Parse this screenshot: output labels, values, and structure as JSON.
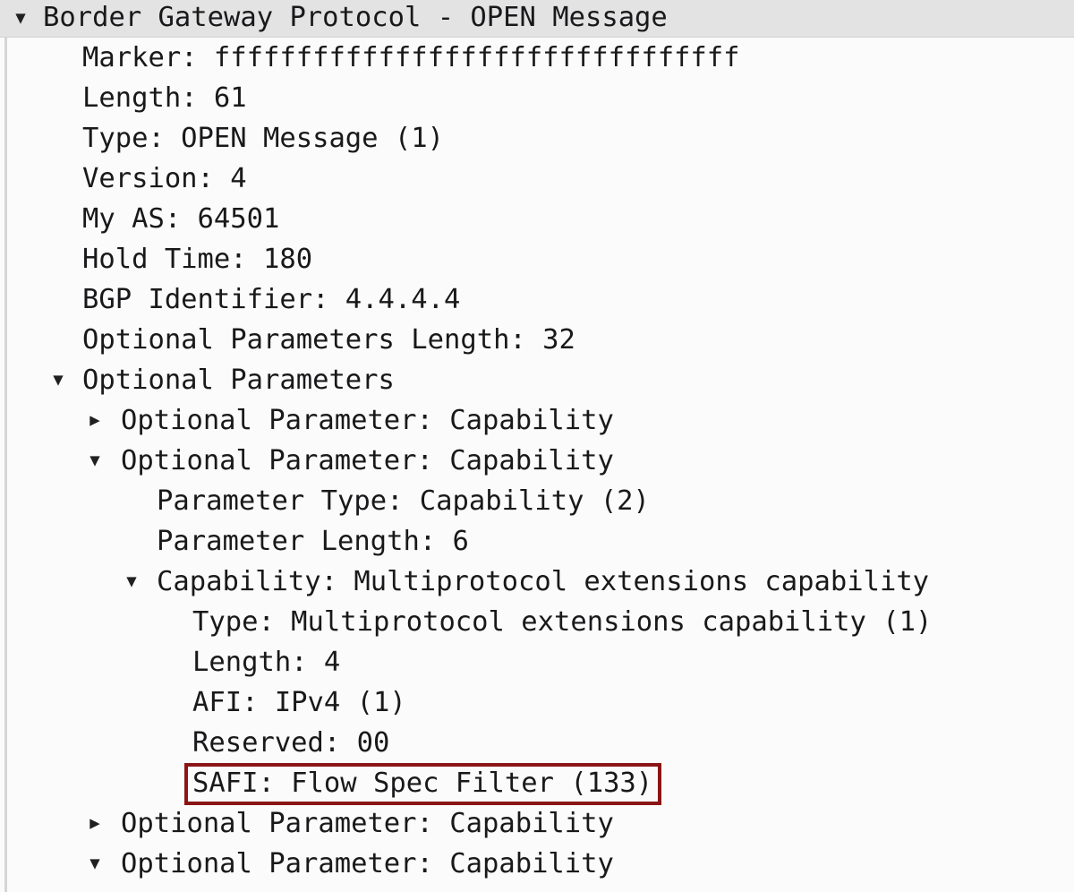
{
  "window": {
    "pane": "packet-details",
    "protocol": "Border Gateway Protocol"
  },
  "colors": {
    "background": "#fbfbfb",
    "header_row_background": "#e3e3e4",
    "text": "#19191b",
    "highlight_border": "#8b1515",
    "tree_guide": "#d5d5d8"
  },
  "icons": {
    "expanded": "▼",
    "collapsed": "▶"
  },
  "tree": {
    "rows": [
      {
        "text": "Border Gateway Protocol - OPEN Message",
        "twisty": "expanded",
        "depth": 0,
        "header": true,
        "highlighted": false
      },
      {
        "text": "Marker: ffffffffffffffffffffffffffffffff",
        "twisty": "none",
        "depth": 1,
        "header": false,
        "highlighted": false
      },
      {
        "text": "Length: 61",
        "twisty": "none",
        "depth": 1,
        "header": false,
        "highlighted": false
      },
      {
        "text": "Type: OPEN Message (1)",
        "twisty": "none",
        "depth": 1,
        "header": false,
        "highlighted": false
      },
      {
        "text": "Version: 4",
        "twisty": "none",
        "depth": 1,
        "header": false,
        "highlighted": false
      },
      {
        "text": "My AS: 64501",
        "twisty": "none",
        "depth": 1,
        "header": false,
        "highlighted": false
      },
      {
        "text": "Hold Time: 180",
        "twisty": "none",
        "depth": 1,
        "header": false,
        "highlighted": false
      },
      {
        "text": "BGP Identifier: 4.4.4.4",
        "twisty": "none",
        "depth": 1,
        "header": false,
        "highlighted": false
      },
      {
        "text": "Optional Parameters Length: 32",
        "twisty": "none",
        "depth": 1,
        "header": false,
        "highlighted": false
      },
      {
        "text": "Optional Parameters",
        "twisty": "expanded",
        "depth": 1,
        "header": false,
        "highlighted": false
      },
      {
        "text": "Optional Parameter: Capability",
        "twisty": "collapsed",
        "depth": 2,
        "header": false,
        "highlighted": false
      },
      {
        "text": "Optional Parameter: Capability",
        "twisty": "expanded",
        "depth": 2,
        "header": false,
        "highlighted": false
      },
      {
        "text": "Parameter Type: Capability (2)",
        "twisty": "none",
        "depth": 3,
        "header": false,
        "highlighted": false
      },
      {
        "text": "Parameter Length: 6",
        "twisty": "none",
        "depth": 3,
        "header": false,
        "highlighted": false
      },
      {
        "text": "Capability: Multiprotocol extensions capability",
        "twisty": "expanded",
        "depth": 3,
        "header": false,
        "highlighted": false
      },
      {
        "text": "Type: Multiprotocol extensions capability (1)",
        "twisty": "none",
        "depth": 4,
        "header": false,
        "highlighted": false
      },
      {
        "text": "Length: 4",
        "twisty": "none",
        "depth": 4,
        "header": false,
        "highlighted": false
      },
      {
        "text": "AFI: IPv4 (1)",
        "twisty": "none",
        "depth": 4,
        "header": false,
        "highlighted": false
      },
      {
        "text": "Reserved: 00",
        "twisty": "none",
        "depth": 4,
        "header": false,
        "highlighted": false
      },
      {
        "text": "SAFI: Flow Spec Filter (133)",
        "twisty": "none",
        "depth": 4,
        "header": false,
        "highlighted": true
      },
      {
        "text": "Optional Parameter: Capability",
        "twisty": "collapsed",
        "depth": 2,
        "header": false,
        "highlighted": false
      },
      {
        "text": "Optional Parameter: Capability",
        "twisty": "expanded",
        "depth": 2,
        "header": false,
        "highlighted": false
      }
    ]
  },
  "fields": {
    "marker": "ffffffffffffffffffffffffffffffff",
    "length": "61",
    "type": "OPEN Message (1)",
    "version": "4",
    "my_as": "64501",
    "hold_time": "180",
    "bgp_identifier": "4.4.4.4",
    "optional_parameters_length": "32",
    "parameter_type": "Capability (2)",
    "parameter_length": "6",
    "capability_type": "Multiprotocol extensions capability (1)",
    "capability_length": "4",
    "afi": "IPv4 (1)",
    "reserved": "00",
    "safi": "Flow Spec Filter (133)"
  }
}
